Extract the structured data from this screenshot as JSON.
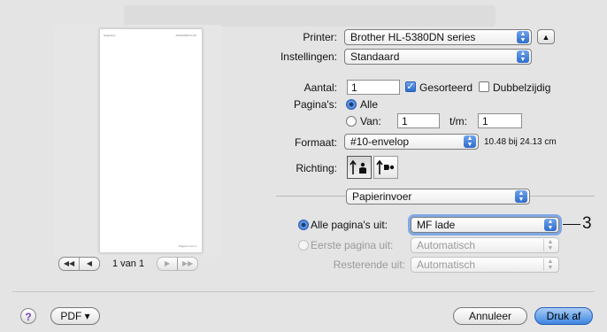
{
  "preview": {
    "header_left": "Naamloos",
    "header_right": "06/04/2009 21:30",
    "footer": "Pagina 1 van 1",
    "page_indicator": "1 van 1",
    "nav_first": "◀◀",
    "nav_prev": "◀",
    "nav_next": "▶",
    "nav_last": "▶▶"
  },
  "printer": {
    "label": "Printer:",
    "value": "Brother HL-5380DN series",
    "expand_glyph": "▲"
  },
  "settings": {
    "label": "Instellingen:",
    "value": "Standaard"
  },
  "copies": {
    "label": "Aantal:",
    "value": "1",
    "collated_label": "Gesorteerd",
    "collated": true,
    "duplex_label": "Dubbelzijdig",
    "duplex": false
  },
  "pages": {
    "label": "Pagina's:",
    "all_label": "Alle",
    "from_label": "Van:",
    "from_value": "1",
    "to_label": "t/m:",
    "to_value": "1"
  },
  "paper_size": {
    "label": "Formaat:",
    "value": "#10-envelop",
    "dimensions": "10.48 bij 24.13 cm"
  },
  "orientation": {
    "label": "Richting:"
  },
  "panel": {
    "value": "Papierinvoer"
  },
  "feed": {
    "all_pages_label": "Alle pagina's uit:",
    "all_pages_value": "MF lade",
    "first_page_label": "Eerste pagina uit:",
    "first_page_value": "Automatisch",
    "remaining_label": "Resterende uit:",
    "remaining_value": "Automatisch"
  },
  "callout": "3",
  "footer": {
    "help": "?",
    "pdf": "PDF ▾",
    "cancel": "Annuleer",
    "print": "Druk af"
  }
}
